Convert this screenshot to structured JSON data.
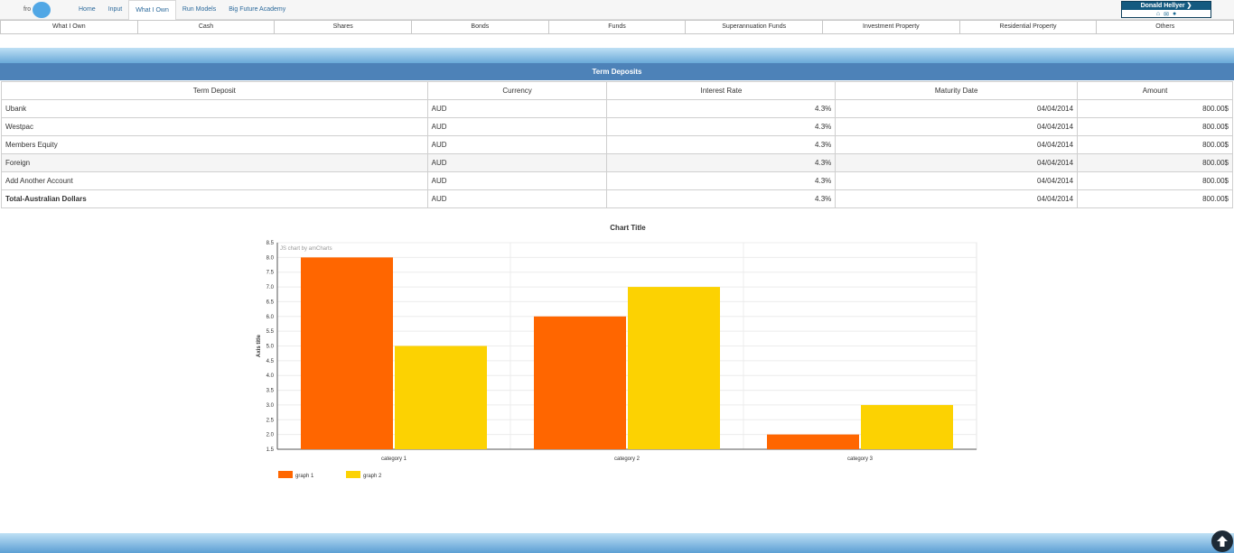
{
  "logo": {
    "text": "fro"
  },
  "nav": {
    "items": [
      {
        "label": "Home"
      },
      {
        "label": "Input"
      },
      {
        "label": "What I Own"
      },
      {
        "label": "Run Models"
      },
      {
        "label": "Big Future Academy"
      }
    ]
  },
  "user": {
    "name": "Donald Hellyer"
  },
  "subtabs": [
    {
      "label": "What I Own"
    },
    {
      "label": "Cash"
    },
    {
      "label": "Shares"
    },
    {
      "label": "Bonds"
    },
    {
      "label": "Funds"
    },
    {
      "label": "Superannuation Funds"
    },
    {
      "label": "Investment Property"
    },
    {
      "label": "Residential Property"
    },
    {
      "label": "Others"
    }
  ],
  "section": {
    "title": "Term Deposits"
  },
  "table": {
    "headers": [
      "Term Deposit",
      "Currency",
      "Interest Rate",
      "Maturity Date",
      "Amount"
    ],
    "rows": [
      {
        "name": "Ubank",
        "currency": "AUD",
        "rate": "4.3%",
        "maturity": "04/04/2014",
        "amount": "800.00$"
      },
      {
        "name": "Westpac",
        "currency": "AUD",
        "rate": "4.3%",
        "maturity": "04/04/2014",
        "amount": "800.00$"
      },
      {
        "name": "Members Equity",
        "currency": "AUD",
        "rate": "4.3%",
        "maturity": "04/04/2014",
        "amount": "800.00$"
      },
      {
        "name": "Foreign",
        "currency": "AUD",
        "rate": "4.3%",
        "maturity": "04/04/2014",
        "amount": "800.00$"
      },
      {
        "name": "Add Another Account",
        "currency": "AUD",
        "rate": "4.3%",
        "maturity": "04/04/2014",
        "amount": "800.00$"
      },
      {
        "name": "Total-Australian Dollars",
        "currency": "AUD",
        "rate": "4.3%",
        "maturity": "04/04/2014",
        "amount": "800.00$"
      }
    ]
  },
  "chart_data": {
    "type": "bar",
    "title": "Chart Title",
    "watermark": "JS chart by amCharts",
    "ylabel": "Axis title",
    "xlabel": "",
    "ylim": [
      1.5,
      8.5
    ],
    "yticks": [
      "1.5",
      "2.0",
      "2.5",
      "3.0",
      "3.5",
      "4.0",
      "4.5",
      "5.0",
      "5.5",
      "6.0",
      "6.5",
      "7.0",
      "7.5",
      "8.0",
      "8.5"
    ],
    "categories": [
      "category 1",
      "category 2",
      "category 3"
    ],
    "series": [
      {
        "name": "graph 1",
        "values": [
          8,
          6,
          2
        ],
        "color": "#FF6600"
      },
      {
        "name": "graph 2",
        "values": [
          5,
          7,
          3
        ],
        "color": "#FCD202"
      }
    ],
    "grid": true,
    "legend": "bottom-left"
  },
  "colors": {
    "accent": "#4d82b8",
    "nav_text": "#2c6a9c"
  }
}
